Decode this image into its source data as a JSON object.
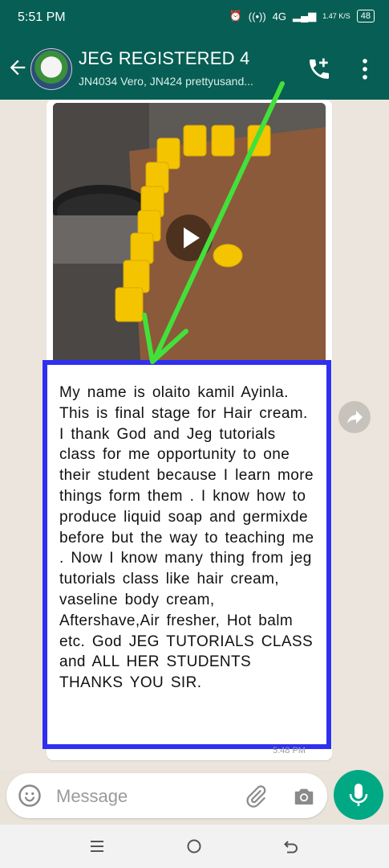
{
  "status_bar": {
    "time": "5:51 PM",
    "network": "4G",
    "speed": "1.47 K/S",
    "battery": "48"
  },
  "chat_header": {
    "title": "JEG REGISTERED 4",
    "subtitle": "JN4034 Vero, JN424  prettyusand..."
  },
  "message": {
    "caption": "My name is olaito kamil Ayinla. This is final stage for Hair cream. I thank God and Jeg tutorials class for me opportunity to one their student because I learn more things form them . I know how to produce liquid soap and germixde before but the way to teaching me . Now I know many thing from jeg tutorials class like hair cream, vaseline body cream, Aftershave,Air fresher, Hot balm etc. God JEG TUTORIALS CLASS and ALL HER STUDENTS THANKS YOU SIR.",
    "time": "5:48 PM"
  },
  "input": {
    "placeholder": "Message"
  },
  "colors": {
    "header": "#075e54",
    "accent": "#00a884",
    "highlight_box": "#2f2ff0",
    "arrow": "#44e03a"
  },
  "icons": [
    "back-arrow-icon",
    "add-call-icon",
    "more-options-icon",
    "play-icon",
    "forward-icon",
    "emoji-icon",
    "attach-icon",
    "camera-icon",
    "mic-icon"
  ]
}
